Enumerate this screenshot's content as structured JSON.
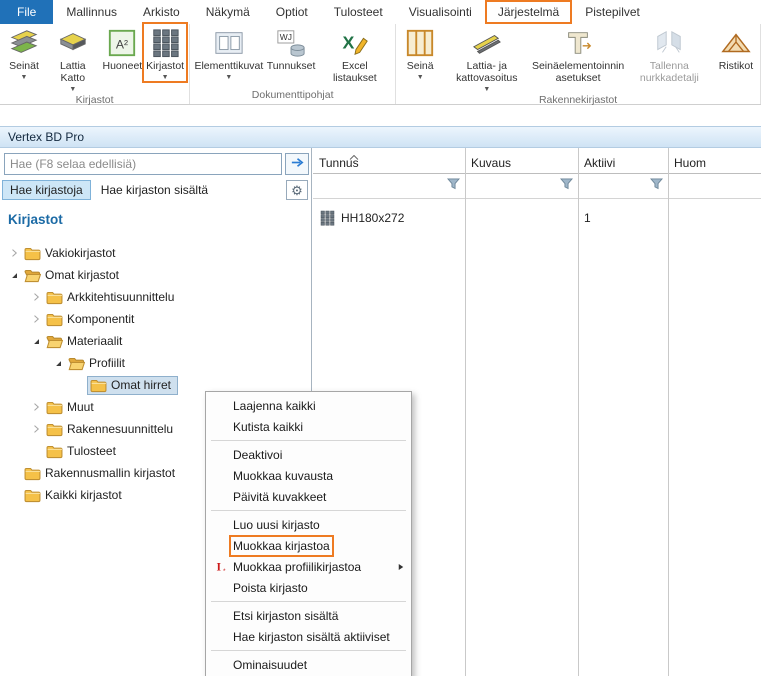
{
  "colors": {
    "annotation_orange": "#ee7b22",
    "file_tab_blue": "#2071b8",
    "tree_heading_blue": "#1b6aa5",
    "selection_blue": "#cfe0ee"
  },
  "ribbon": {
    "tabs": [
      {
        "label": "File",
        "active": true
      },
      {
        "label": "Mallinnus"
      },
      {
        "label": "Arkisto"
      },
      {
        "label": "Näkymä"
      },
      {
        "label": "Optiot"
      },
      {
        "label": "Tulosteet"
      },
      {
        "label": "Visualisointi"
      },
      {
        "label": "Järjestelmä",
        "highlighted": true
      },
      {
        "label": "Pistepilvet"
      }
    ],
    "groups": [
      {
        "label": "Kirjastot",
        "buttons": [
          {
            "label": "Seinät",
            "icon": "walls",
            "dropdown": true
          },
          {
            "label": "Lattia Katto",
            "icon": "floor-ceiling",
            "dropdown": true
          },
          {
            "label": "Huoneet",
            "icon": "rooms"
          },
          {
            "label": "Kirjastot",
            "icon": "libraries",
            "dropdown": true,
            "highlighted": true
          }
        ]
      },
      {
        "label": "Dokumenttipohjat",
        "buttons": [
          {
            "label": "Elementtikuvat",
            "icon": "element-drawings",
            "dropdown": true
          },
          {
            "label": "Tunnukset",
            "icon": "labels"
          },
          {
            "label": "Excel listaukset",
            "icon": "excel"
          }
        ]
      },
      {
        "label": "Rakennekirjastot",
        "buttons": [
          {
            "label": "Seinä",
            "icon": "wall",
            "dropdown": true
          },
          {
            "label": "Lattia- ja kattovasoitus",
            "icon": "floor-joists",
            "dropdown": true
          },
          {
            "label": "Seinäelementoinnin asetukset",
            "icon": "panel-settings"
          },
          {
            "label": "Tallenna nurkkadetalji",
            "icon": "save-corner",
            "disabled": true
          },
          {
            "label": "Ristikot",
            "icon": "trusses"
          }
        ]
      }
    ]
  },
  "window": {
    "title": "Vertex BD Pro"
  },
  "search": {
    "placeholder": "Hae (F8 selaa edellisiä)"
  },
  "panel": {
    "tabs": [
      {
        "label": "Hae kirjastoja",
        "active": true
      },
      {
        "label": "Hae kirjaston sisältä"
      }
    ]
  },
  "tree": {
    "heading": "Kirjastot",
    "items": [
      {
        "label": "Vakiokirjastot",
        "level": 1,
        "expand": "collapsed"
      },
      {
        "label": "Omat kirjastot",
        "level": 1,
        "expand": "expanded"
      },
      {
        "label": "Arkkitehtisuunnittelu",
        "level": 2,
        "expand": "collapsed"
      },
      {
        "label": "Komponentit",
        "level": 2,
        "expand": "collapsed"
      },
      {
        "label": "Materiaalit",
        "level": 2,
        "expand": "expanded"
      },
      {
        "label": "Profiilit",
        "level": 3,
        "expand": "expanded"
      },
      {
        "label": "Omat hirret",
        "level": 4,
        "selected": true
      },
      {
        "label": "Muut",
        "level": 2,
        "expand": "collapsed"
      },
      {
        "label": "Rakennesuunnittelu",
        "level": 2,
        "expand": "collapsed"
      },
      {
        "label": "Tulosteet",
        "level": 2
      },
      {
        "label": "Rakennusmallin kirjastot",
        "level": 1
      },
      {
        "label": "Kaikki kirjastot",
        "level": 1
      }
    ]
  },
  "table": {
    "columns": [
      {
        "label": "Tunnus",
        "sorted": true,
        "filter": true
      },
      {
        "label": "Kuvaus",
        "filter": true
      },
      {
        "label": "Aktiivi",
        "filter": true
      },
      {
        "label": "Huom"
      }
    ],
    "rows": [
      {
        "icon": true,
        "cells": [
          "HH180x272",
          "",
          "1",
          ""
        ]
      }
    ]
  },
  "context_menu": {
    "items": [
      {
        "label": "Laajenna kaikki"
      },
      {
        "label": "Kutista kaikki"
      },
      {
        "separator": true
      },
      {
        "label": "Deaktivoi"
      },
      {
        "label": "Muokkaa kuvausta"
      },
      {
        "label": "Päivitä kuvakkeet"
      },
      {
        "separator": true
      },
      {
        "label": "Luo uusi kirjasto"
      },
      {
        "label": "Muokkaa kirjastoa",
        "highlighted": true
      },
      {
        "label": "Muokkaa profiilikirjastoa",
        "icon": "profile-library",
        "submenu": true
      },
      {
        "label": "Poista kirjasto"
      },
      {
        "separator": true
      },
      {
        "label": "Etsi kirjaston sisältä"
      },
      {
        "label": "Hae kirjaston sisältä aktiiviset"
      },
      {
        "separator": true
      },
      {
        "label": "Ominaisuudet"
      }
    ]
  }
}
